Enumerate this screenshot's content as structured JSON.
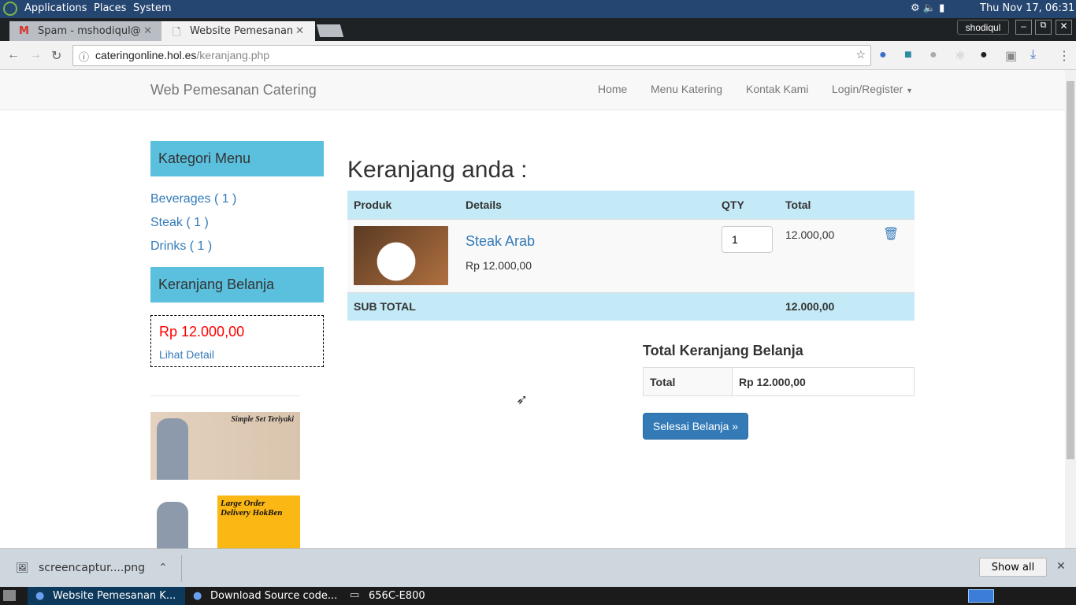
{
  "system": {
    "menus": [
      "Applications",
      "Places",
      "System"
    ],
    "clock": "Thu Nov 17, 06:31"
  },
  "browser": {
    "tabs": [
      {
        "label": "Spam - mshodiqul@",
        "icon": "gmail-icon"
      },
      {
        "label": "Website Pemesanan",
        "icon": "page-icon"
      }
    ],
    "profile": "shodiqul",
    "url_host": "cateringonline.hol.es",
    "url_path": "/keranjang.php"
  },
  "site": {
    "brand": "Web Pemesanan Catering",
    "nav": [
      "Home",
      "Menu Katering",
      "Kontak Kami",
      "Login/Register"
    ]
  },
  "sidebar": {
    "kategori_title": "Kategori Menu",
    "categories": [
      "Beverages ( 1 )",
      "Steak ( 1 )",
      "Drinks ( 1 )"
    ],
    "cart_title": "Keranjang Belanja",
    "cart_total": "Rp 12.000,00",
    "cart_link": "Lihat Detail",
    "ads": [
      "Simple Set Teriyaki",
      "Large Order Delivery HokBen"
    ]
  },
  "cart": {
    "title": "Keranjang anda :",
    "headers": [
      "Produk",
      "Details",
      "QTY",
      "Total"
    ],
    "items": [
      {
        "name": "Steak Arab",
        "price": "Rp 12.000,00",
        "qty": "1",
        "total": "12.000,00"
      }
    ],
    "subtotal_label": "SUB TOTAL",
    "subtotal": "12.000,00",
    "summary_title": "Total Keranjang Belanja",
    "summary_label": "Total",
    "summary_value": "Rp 12.000,00",
    "checkout": "Selesai Belanja »"
  },
  "downloads": {
    "file": "screencaptur....png",
    "show_all": "Show all"
  },
  "taskbar": [
    "Website Pemesanan K...",
    "Download Source code...",
    "656C-E800"
  ],
  "colors": {
    "panel": "#5bc0de",
    "info_row": "#c4eaf7",
    "link": "#337ab7",
    "price_red": "#ff0000",
    "button": "#337ab7"
  }
}
